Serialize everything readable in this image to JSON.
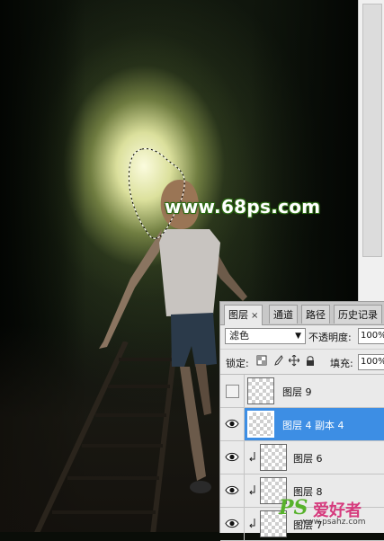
{
  "canvas": {
    "watermark_text": "www.68ps.com"
  },
  "layers_panel": {
    "tabs": [
      {
        "label": "图层",
        "close": "×",
        "active": true
      },
      {
        "label": "通道",
        "active": false
      },
      {
        "label": "路径",
        "active": false
      },
      {
        "label": "历史记录",
        "active": false
      }
    ],
    "blend_mode": "滤色",
    "opacity_label": "不透明度:",
    "opacity_value": "100%",
    "lock_label": "锁定:",
    "fill_label": "填充:",
    "fill_value": "100%",
    "layers": [
      {
        "name": "图层 9",
        "visible": false,
        "selected": false,
        "clipped": false
      },
      {
        "name": "图层 4 副本 4",
        "visible": true,
        "selected": true,
        "clipped": false
      },
      {
        "name": "图层 6",
        "visible": true,
        "selected": false,
        "clipped": true
      },
      {
        "name": "图层 8",
        "visible": true,
        "selected": false,
        "clipped": true
      },
      {
        "name": "图层 7",
        "visible": true,
        "selected": false,
        "clipped": true
      }
    ]
  },
  "logo": {
    "ps": "PS",
    "cn": "爱好者",
    "url": "www.psahz.com"
  },
  "colors": {
    "selected_layer": "#3d8ee4",
    "panel_bg": "#eaeaea",
    "watermark_outline": "#2b6b12",
    "logo_green": "#57b22b",
    "logo_pink": "#d63a7d"
  }
}
